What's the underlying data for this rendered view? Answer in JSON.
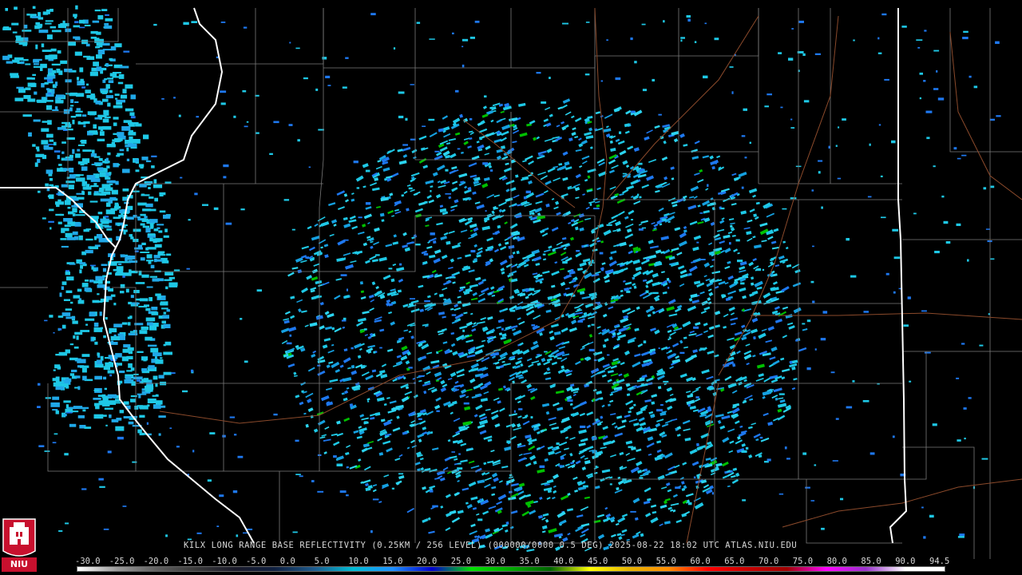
{
  "product": {
    "radar": "KILX",
    "caption": "KILX LONG RANGE BASE REFLECTIVITY (0.25KM / 256 LEVEL) (000000/0000 0.5 DEG) 2025-08-22 18:02 UTC  ATLAS.NIU.EDU"
  },
  "logo": {
    "text": "NIU"
  },
  "colorbar": {
    "labels": [
      "-30.0",
      "-25.0",
      "-20.0",
      "-15.0",
      "-10.0",
      "-5.0",
      "0.0",
      "5.0",
      "10.0",
      "15.0",
      "20.0",
      "25.0",
      "30.0",
      "35.0",
      "40.0",
      "45.0",
      "50.0",
      "55.0",
      "60.0",
      "65.0",
      "70.0",
      "75.0",
      "80.0",
      "85.0",
      "90.0",
      "94.5"
    ],
    "gradient": [
      "#ffffff",
      "#9a9a9a",
      "#606060",
      "#3a3a3a",
      "#1a1a2a",
      "#102040",
      "#1e5a8c",
      "#00bcd4",
      "#1e90ff",
      "#0000cd",
      "#00e000",
      "#00a800",
      "#006400",
      "#ffff00",
      "#e6b400",
      "#ff8c00",
      "#ff0000",
      "#c80000",
      "#a00000",
      "#ff00ff",
      "#9932cc",
      "#ffffff",
      "#ffffff"
    ]
  },
  "colors": {
    "background": "#000000",
    "county_lines": "#7a7a7a",
    "state_lines": "#ffffff",
    "highways": "#8b4a2b",
    "echo_cyan": "#1ec8e6",
    "echo_blue": "#1e78f0",
    "echo_green": "#00c000"
  }
}
